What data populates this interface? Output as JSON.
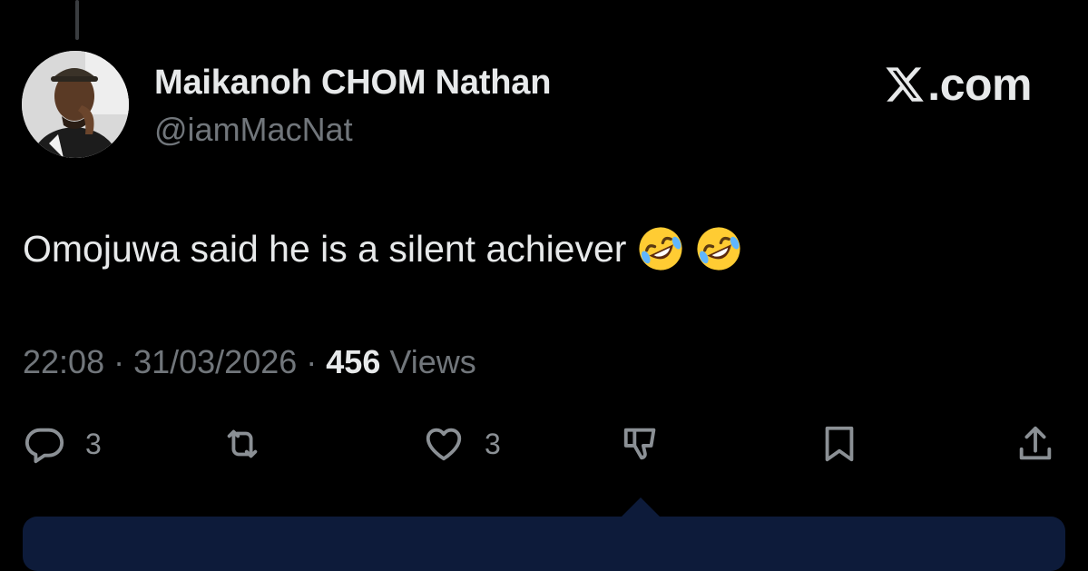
{
  "author": {
    "display_name": "Maikanoh CHOM Nathan",
    "handle": "@iamMacNat"
  },
  "brand": {
    "label": ".com",
    "icon": "x-logo-icon"
  },
  "tweet": {
    "text": "Omojuwa said he is a silent achiever",
    "emojis": [
      "rolling-on-floor-laughing-emoji",
      "rolling-on-floor-laughing-emoji"
    ]
  },
  "meta": {
    "time": "22:08",
    "separator": " · ",
    "date": "31/03/2026",
    "views_count": "456",
    "views_label": " Views"
  },
  "actions": {
    "reply": {
      "icon": "reply-icon",
      "count": "3"
    },
    "repost": {
      "icon": "repost-icon"
    },
    "like": {
      "icon": "heart-icon",
      "count": "3"
    },
    "dislike": {
      "icon": "thumbs-down-icon"
    },
    "bookmark": {
      "icon": "bookmark-icon"
    },
    "share": {
      "icon": "share-icon"
    }
  },
  "colors": {
    "background": "#000000",
    "text_primary": "#e7e9ea",
    "text_secondary": "#71767b",
    "icon": "#8b9095",
    "tooltip": "#0d1b3a"
  }
}
